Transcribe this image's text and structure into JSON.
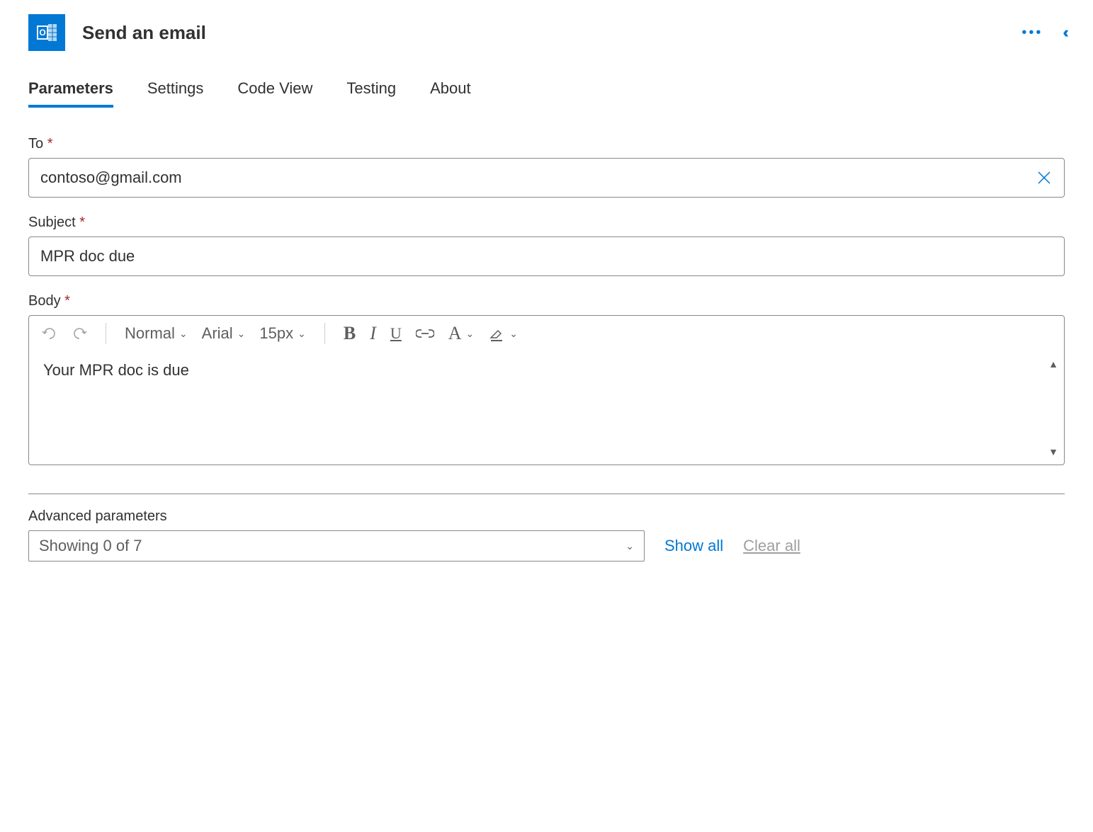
{
  "header": {
    "title": "Send an email"
  },
  "tabs": {
    "items": [
      "Parameters",
      "Settings",
      "Code View",
      "Testing",
      "About"
    ],
    "active": 0
  },
  "fields": {
    "to": {
      "label": "To",
      "value": "contoso@gmail.com"
    },
    "subject": {
      "label": "Subject",
      "value": "MPR doc due"
    },
    "body": {
      "label": "Body",
      "value": "Your MPR doc is due"
    }
  },
  "rte": {
    "format": "Normal",
    "font": "Arial",
    "size": "15px"
  },
  "advanced": {
    "label": "Advanced parameters",
    "selectText": "Showing 0 of 7",
    "showAll": "Show all",
    "clearAll": "Clear all"
  }
}
